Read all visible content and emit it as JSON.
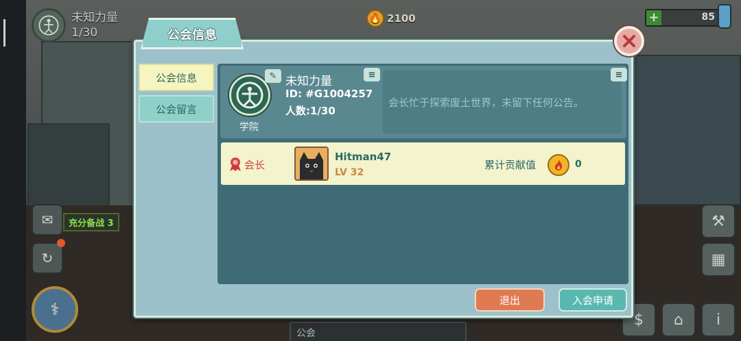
{
  "hud": {
    "guild_name": "未知力量",
    "guild_count": "1/30",
    "currency": "2100",
    "energy": "85",
    "war_label": "充分备战 3",
    "bottom_tab": "公会"
  },
  "dialog": {
    "title": "公会信息",
    "tabs": [
      {
        "label": "公会信息",
        "active": true
      },
      {
        "label": "公会留言",
        "active": false
      }
    ],
    "guild": {
      "name": "未知力量",
      "id": "ID: #G1004257",
      "members": "人数:1/30",
      "type": "学院",
      "notice": "会长忙于探索废土世界，未留下任何公告。"
    },
    "members": [
      {
        "rank": "会长",
        "name": "Hitman47",
        "level": "LV 32",
        "contribution_label": "累计贡献值",
        "contribution_value": "0"
      }
    ],
    "buttons": {
      "quit": "退出",
      "apply": "入会申请"
    }
  },
  "colors": {
    "dialog_bg": "#9dc1cb",
    "panel_bg": "#3e6b76",
    "row_bg": "#f3f3cd",
    "active_tab": "#f6f4bf",
    "quit_button": "#e07a52",
    "apply_button": "#59b8b0",
    "close_button": "#e8a9a5"
  },
  "icons": {
    "close": "close-x-icon",
    "edit": "edit-icon",
    "emblem": "vitruvian-emblem-icon",
    "rank": "red-rosette-icon",
    "contribution": "flame-coin-icon"
  }
}
